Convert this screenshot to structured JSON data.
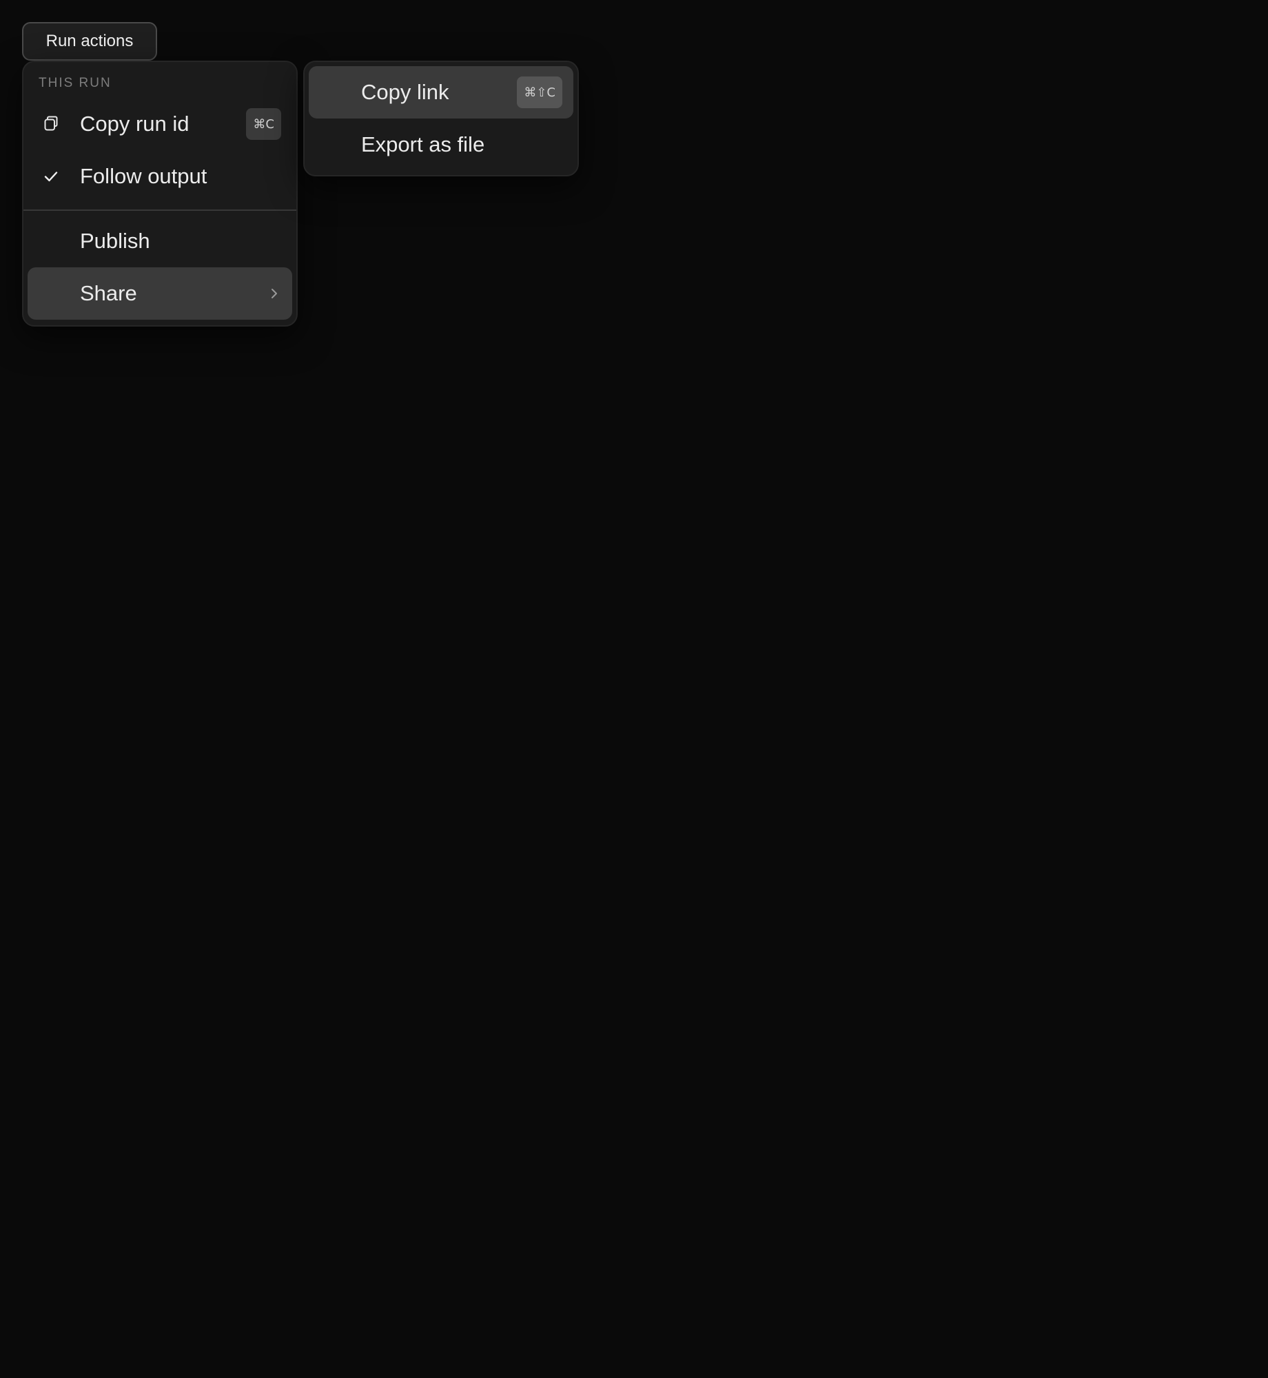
{
  "trigger": {
    "label": "Run actions"
  },
  "menu": {
    "section_label": "THIS RUN",
    "items": [
      {
        "label": "Copy run id",
        "shortcut": "⌘C",
        "icon": "copy-icon"
      },
      {
        "label": "Follow output",
        "icon": "check-icon",
        "checked": true
      },
      {
        "label": "Publish"
      },
      {
        "label": "Share",
        "icon": "chevron-right-icon",
        "highlighted": true
      }
    ]
  },
  "submenu": {
    "items": [
      {
        "label": "Copy link",
        "shortcut": "⌘⇧C",
        "highlighted": true
      },
      {
        "label": "Export as file"
      }
    ]
  },
  "colors": {
    "background": "#0a0a0a",
    "menu_surface": "#1b1b1b",
    "highlight": "#3a3a3a",
    "text": "#ececec",
    "muted_text": "#7d7d7d"
  }
}
